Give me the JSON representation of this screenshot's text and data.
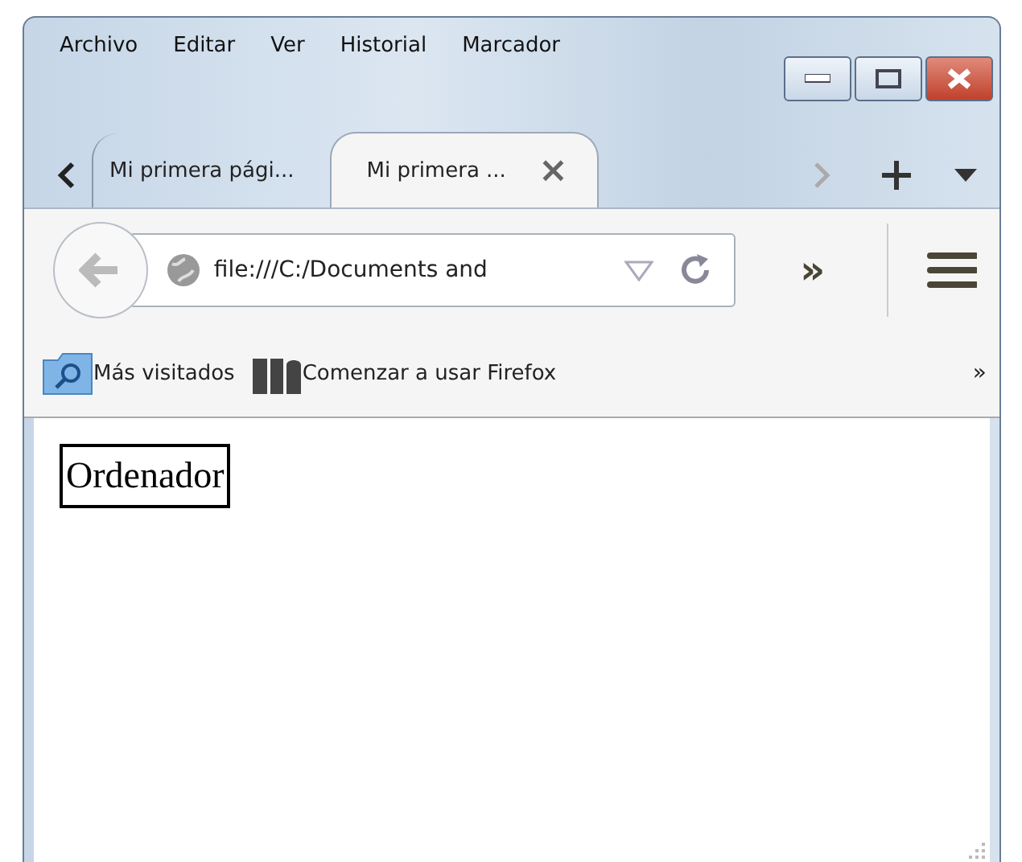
{
  "menu": [
    "Archivo",
    "Editar",
    "Ver",
    "Historial",
    "Marcador"
  ],
  "tabs": [
    {
      "label": "Mi primera pági...",
      "selected": false,
      "closable": false
    },
    {
      "label": "Mi primera ...",
      "selected": true,
      "closable": true
    }
  ],
  "close_tab": "×",
  "address": {
    "value": "file:///C:/Documents and"
  },
  "overflow": "»",
  "bookmarks": [
    {
      "label": "Más visitados",
      "kind": "folder"
    },
    {
      "label": "Comenzar a usar Firefox",
      "kind": "site"
    }
  ],
  "bookmarks_overflow": "»",
  "content": {
    "text": "Ordenador"
  }
}
